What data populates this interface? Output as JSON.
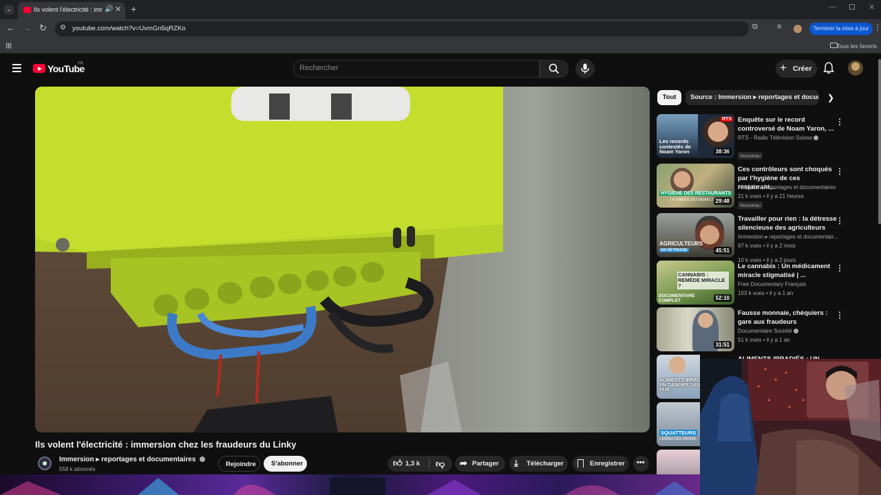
{
  "browser": {
    "tab_title": "Ils volent l'électricité : imme",
    "url": "youtube.com/watch?v=UvmGn5qRZKo",
    "update_button": "Terminer la mise à jour",
    "bookmarks_all": "Tous les favoris"
  },
  "header": {
    "logo": "YouTube",
    "region": "FR",
    "search_placeholder": "Rechercher",
    "create_label": "Créer"
  },
  "video": {
    "title": "Ils volent l'électricité : immersion chez les fraudeurs du Linky",
    "channel": "Immersion ▸ reportages et documentaires",
    "subscribers": "558 k abonnés",
    "join_label": "Rejoindre",
    "subscribe_label": "S'abonner",
    "likes": "1,3 k",
    "share_label": "Partager",
    "download_label": "Télécharger",
    "save_label": "Enregistrer"
  },
  "sidebar": {
    "chips": [
      "Tout",
      "Source : Immersion ▸ reportages et documentaires"
    ],
    "recommendations": [
      {
        "title": "Enquête sur le record controversé de Noam Yaron, ...",
        "channel": "RTS - Radio Télévision Suisse",
        "meta": "10 k vues • il y a 2 jours",
        "badge": "Nouveau",
        "duration": "38:36",
        "thumb_text": "Les records contestés de Noam Yaron",
        "thumb_brand": "RTS"
      },
      {
        "title": "Ces contrôleurs sont choqués par l'hygiène de ces restaurant...",
        "channel": "750g TV - Reportages et documentaires",
        "meta": "21 k vues • il y a 21 heures",
        "badge": "Nouveau",
        "duration": "29:48",
        "thumb_text": "HYGIÈNE DES RESTAURANTS",
        "thumb_sub": "LA TRAQUE DES INSPECTEURS"
      },
      {
        "title": "Travailler pour rien : la détresse silencieuse des agriculteurs",
        "channel": "Immersion ▸ reportages et documentair...",
        "meta": "97 k vues • il y a 2 mois",
        "duration": "45:51",
        "thumb_text": "AGRICULTEURS",
        "thumb_sub": "EN DÉTRESSE"
      },
      {
        "title": "Le cannabis : Un médicament miracle stigmatisé | ...",
        "channel": "Free Documentary Français",
        "meta": "103 k vues • il y a 1 an",
        "duration": "52:10",
        "thumb_text": "CANNABIS : REMÈDE MIRACLE ?",
        "thumb_sub": "DOCUMENTAIRE COMPLET"
      },
      {
        "title": "Fausse monnaie, chéquiers : gare aux fraudeurs",
        "channel": "Documentaire Société",
        "meta": "51 k vues • il y a 1 an",
        "duration": "31:51"
      },
      {
        "title": "ALIMENTS IRRADIÉS : UN",
        "thumb_text": "ALIMENTS IRRADIÉS UN DANGER SANTÉ PUB"
      },
      {
        "title": "",
        "thumb_text": "SQUATTEURS",
        "thumb_sub": "L'ENFER DES PROPRI"
      },
      {
        "title": ""
      }
    ]
  }
}
